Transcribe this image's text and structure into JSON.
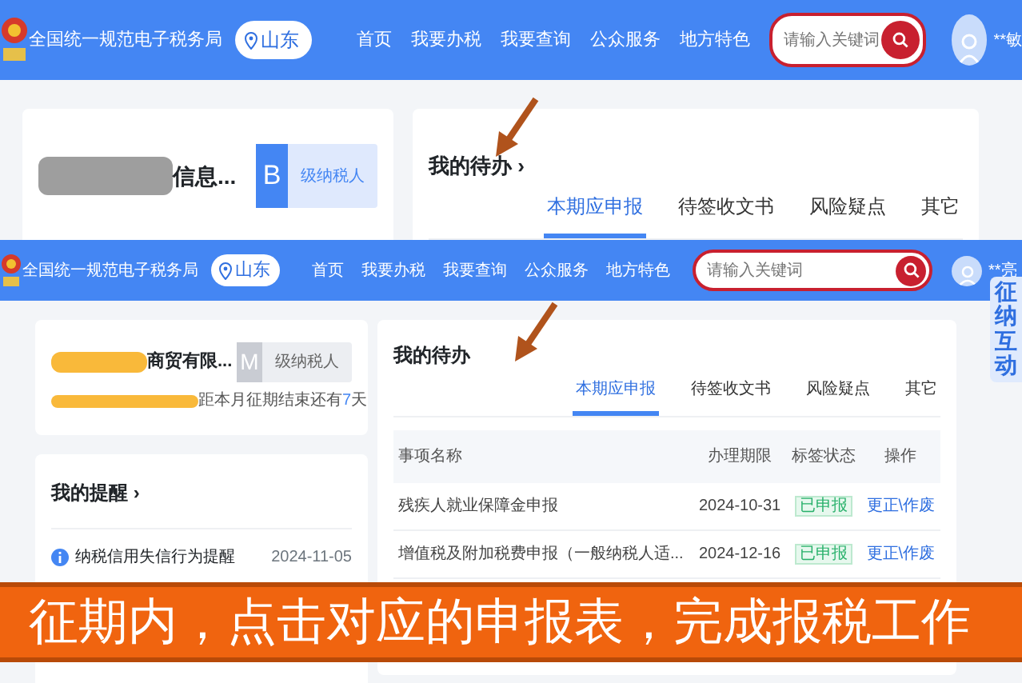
{
  "screens": [
    {
      "header": {
        "title": "全国统一规范电子税务局",
        "region": "山东",
        "nav": [
          "首页",
          "我要办税",
          "我要查询",
          "公众服务",
          "地方特色"
        ],
        "search_placeholder": "请输入关键词",
        "user": "**敏"
      },
      "taxpayer": {
        "redaction": {
          "color": "#9e9e9e"
        },
        "name_suffix": "信息...",
        "grade": "B",
        "grade_label": "级纳税人"
      },
      "todo": {
        "title": "我的待办",
        "chevron": "›",
        "tabs": [
          {
            "label": "本期应申报",
            "selected": true
          },
          {
            "label": "待签收文书",
            "selected": false
          },
          {
            "label": "风险疑点",
            "selected": false
          },
          {
            "label": "其它",
            "selected": false
          }
        ]
      }
    },
    {
      "header": {
        "title": "全国统一规范电子税务局",
        "region": "山东",
        "nav": [
          "首页",
          "我要办税",
          "我要查询",
          "公众服务",
          "地方特色"
        ],
        "search_placeholder": "请输入关键词",
        "user": "**亮"
      },
      "assistant": "征纳互动",
      "taxpayer": {
        "redaction": {
          "color": "#f9b93a"
        },
        "name_suffix": "商贸有限...",
        "grade": "M",
        "grade_label": "级纳税人",
        "deadline_prefix": "距本月征期结束还有",
        "deadline_days": "7",
        "deadline_suffix": "天"
      },
      "reminders": {
        "title": "我的提醒",
        "chevron": "›",
        "items": [
          {
            "text": "纳税信用失信行为提醒",
            "date": "2024-11-05"
          }
        ]
      },
      "todo": {
        "title": "我的待办",
        "tabs": [
          {
            "label": "本期应申报",
            "selected": true
          },
          {
            "label": "待签收文书",
            "selected": false
          },
          {
            "label": "风险疑点",
            "selected": false
          },
          {
            "label": "其它",
            "selected": false
          }
        ],
        "table": {
          "columns": [
            "事项名称",
            "办理期限",
            "标签状态",
            "操作"
          ],
          "rows": [
            {
              "name": "残疾人就业保障金申报",
              "deadline": "2024-10-31",
              "status": "已申报",
              "action": "更正\\作废"
            },
            {
              "name": "增值税及附加税费申报（一般纳税人适...",
              "deadline": "2024-12-16",
              "status": "已申报",
              "action": "更正\\作废"
            }
          ]
        }
      }
    }
  ],
  "caption": "征期内，点击对应的申报表，完成报税工作"
}
